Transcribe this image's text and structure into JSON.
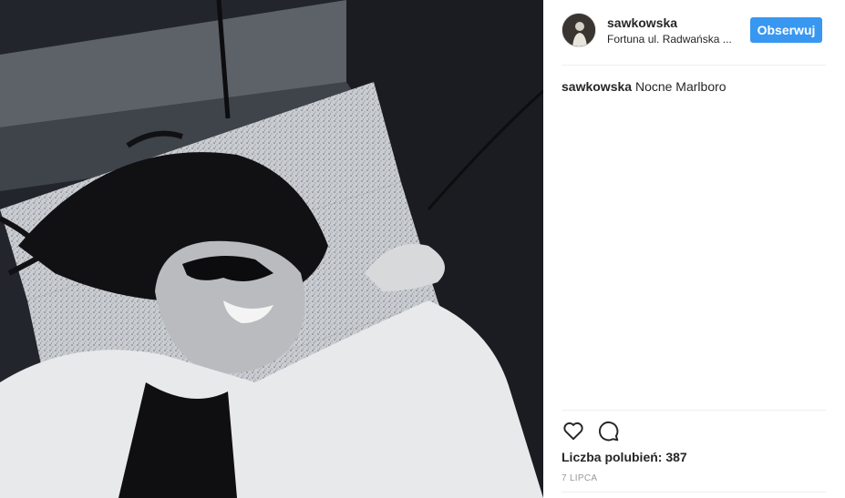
{
  "post": {
    "image_alt": "black and white photo of a woman in sunglasses lying on granite stairs",
    "header": {
      "username": "sawkowska",
      "location": "Fortuna ul. Radwańska ...",
      "follow_label": "Obserwuj"
    },
    "caption": {
      "username": "sawkowska",
      "text": "Nocne Marlboro"
    },
    "actions": {
      "like_icon": "heart-outline-icon",
      "comment_icon": "comment-bubble-icon"
    },
    "likes_text": "Liczba polubień: 387",
    "date": "7 LIPCA"
  },
  "colors": {
    "accent": "#3897f0",
    "text": "#262626",
    "muted": "#999999",
    "divider": "#efefef"
  }
}
